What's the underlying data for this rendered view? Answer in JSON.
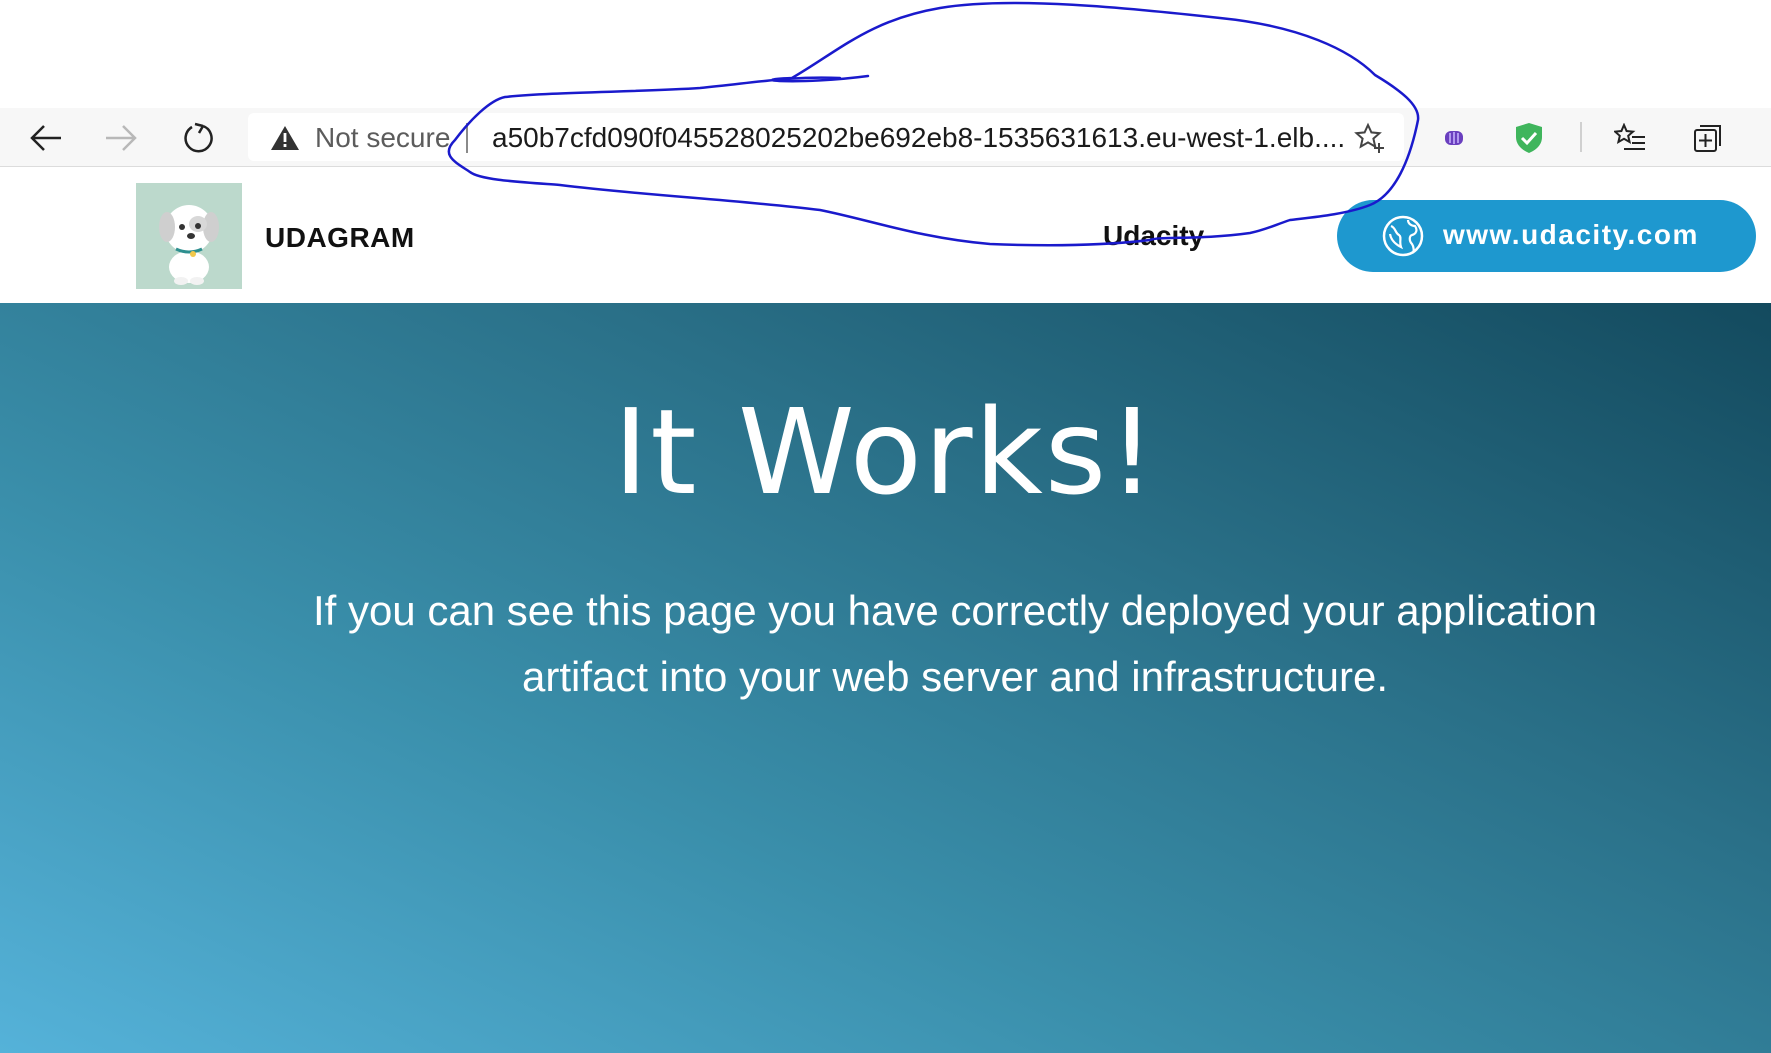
{
  "browser": {
    "back_icon": "arrow-left-icon",
    "forward_icon": "arrow-right-icon",
    "reload_icon": "reload-icon",
    "security_label": "Not secure",
    "url": "a50b7cfd090f045528025202be692eb8-1535631613.eu-west-1.elb....",
    "extension_icons": [
      "extension-purple-icon",
      "shield-check-icon",
      "favorites-list-icon",
      "collections-icon"
    ]
  },
  "header": {
    "brand": "UDAGRAM",
    "nav_link": "Udacity",
    "cta_label": "www.udacity.com"
  },
  "hero": {
    "title": "It Works!",
    "message": "If you can see this page you have correctly deployed your application artifact into your web server and infrastructure."
  },
  "colors": {
    "cta": "#1e98cf",
    "hero_start": "#55b2d9",
    "hero_end": "#134a5e",
    "annotation": "#1a1acc"
  }
}
